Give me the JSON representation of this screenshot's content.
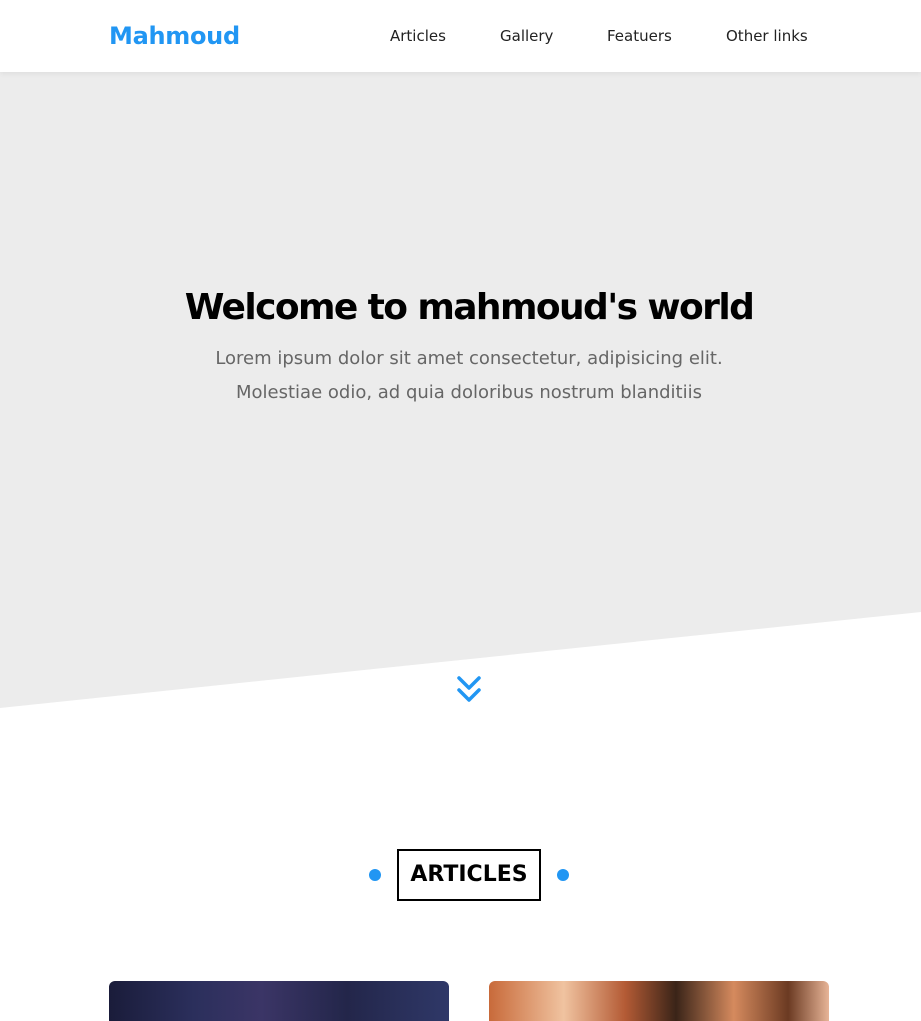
{
  "header": {
    "logo": "Mahmoud",
    "nav": [
      {
        "label": "Articles"
      },
      {
        "label": "Gallery"
      },
      {
        "label": "Featuers"
      },
      {
        "label": "Other links"
      }
    ]
  },
  "landing": {
    "title": "Welcome to mahmoud's world",
    "text_line_1": "Lorem ipsum dolor sit amet consectetur, adipisicing elit.",
    "text_line_2": "Molestiae odio, ad quia doloribus nostrum blanditiis",
    "scroll_icon": "double-chevron-down-icon"
  },
  "articles": {
    "title": "ARTICLES"
  },
  "colors": {
    "accent": "#2196f3",
    "landing_bg": "#ececec",
    "text_muted": "#666666"
  }
}
